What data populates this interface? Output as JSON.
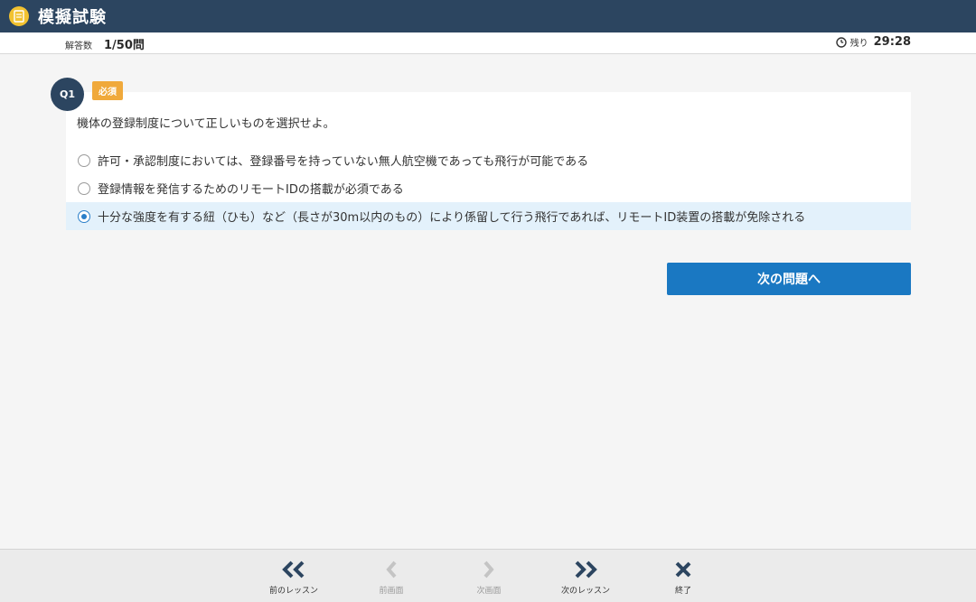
{
  "app": {
    "title": "模擬試験"
  },
  "status": {
    "answered_label": "解答数",
    "answered_value": "1/50問",
    "remaining_label": "残り",
    "remaining_time": "29:28"
  },
  "question": {
    "number_label": "Q1",
    "required_label": "必須",
    "text": "機体の登録制度について正しいものを選択せよ。",
    "options": [
      {
        "label": "許可・承認制度においては、登録番号を持っていない無人航空機であっても飛行が可能である",
        "selected": false
      },
      {
        "label": "登録情報を発信するためのリモートIDの搭載が必須である",
        "selected": false
      },
      {
        "label": "十分な強度を有する紐（ひも）など（長さが30m以内のもの）により係留して行う飛行であれば、リモートID装置の搭載が免除される",
        "selected": true
      }
    ]
  },
  "actions": {
    "next_question_label": "次の問題へ"
  },
  "footer": {
    "prev_lesson": "前のレッスン",
    "prev_screen": "前画面",
    "next_screen": "次画面",
    "next_lesson": "次のレッスン",
    "exit": "終了"
  },
  "colors": {
    "header_bg": "#2c4560",
    "accent_blue": "#1a78c2",
    "required_orange": "#f0a93b",
    "selected_bg": "#e3f1fb"
  }
}
